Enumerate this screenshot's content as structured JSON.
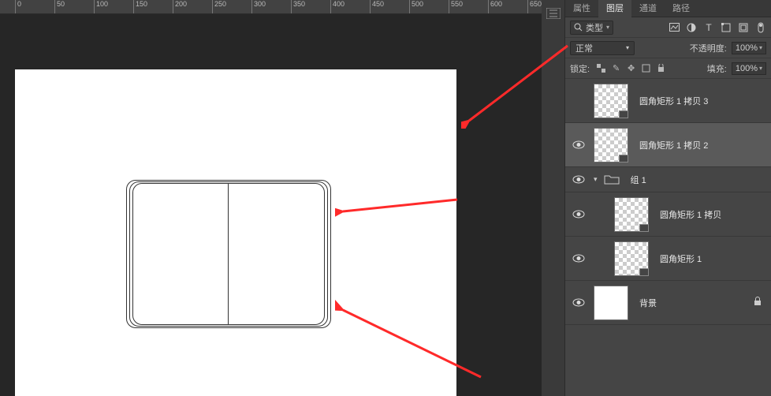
{
  "ruler": {
    "ticks": [
      0,
      50,
      100,
      150,
      200,
      250,
      300,
      350,
      400,
      450,
      500,
      550,
      600,
      650
    ]
  },
  "panel": {
    "tabs": {
      "properties": "属性",
      "layers": "图层",
      "channels": "通道",
      "paths": "路径"
    },
    "filter": {
      "search_icon": "search",
      "kind_label": "类型"
    },
    "filter_icons": [
      "image",
      "adjust",
      "type",
      "shape",
      "smart",
      "toggle"
    ],
    "blend": {
      "mode": "正常",
      "opacity_label": "不透明度:",
      "opacity_value": "100%"
    },
    "lock": {
      "label": "锁定:",
      "fill_label": "填充:",
      "fill_value": "100%"
    },
    "lock_icons": [
      "pixels",
      "brush",
      "move",
      "artboard",
      "all"
    ]
  },
  "layers": [
    {
      "id": "l1",
      "visible": false,
      "indent": 0,
      "thumb": "checker",
      "badge": true,
      "name": "圆角矩形 1 拷贝 3",
      "selected": false
    },
    {
      "id": "l2",
      "visible": true,
      "indent": 0,
      "thumb": "checker",
      "badge": true,
      "name": "圆角矩形 1 拷贝 2",
      "selected": true
    },
    {
      "id": "g1",
      "visible": true,
      "indent": 0,
      "group": true,
      "expanded": true,
      "name": "组 1"
    },
    {
      "id": "l3",
      "visible": true,
      "indent": 1,
      "thumb": "checker",
      "badge": true,
      "name": "圆角矩形 1 拷贝",
      "selected": false
    },
    {
      "id": "l4",
      "visible": true,
      "indent": 1,
      "thumb": "checker",
      "badge": true,
      "name": "圆角矩形 1",
      "selected": false
    },
    {
      "id": "bg",
      "visible": true,
      "indent": 0,
      "thumb": "white",
      "badge": false,
      "name": "背景",
      "locked": true
    }
  ]
}
